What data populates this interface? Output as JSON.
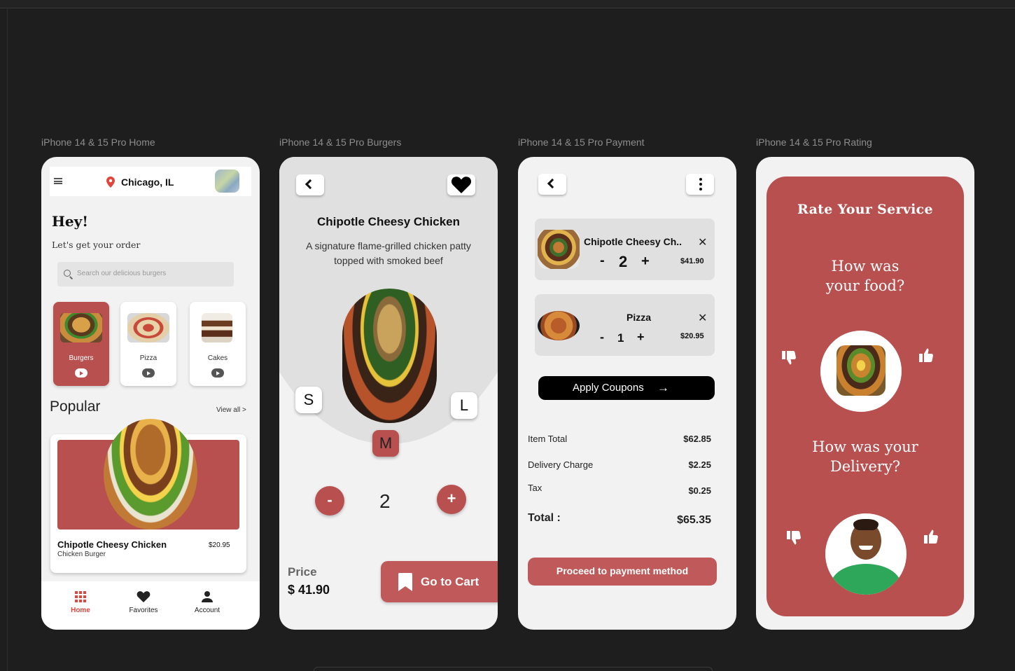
{
  "frames": {
    "home_label": "iPhone 14 & 15 Pro Home",
    "burgers_label": "iPhone 14 & 15 Pro Burgers",
    "payment_label": "iPhone 14 & 15 Pro Payment",
    "rating_label": "iPhone 14 & 15 Pro Rating"
  },
  "home": {
    "location": "Chicago, IL",
    "greeting": "Hey!",
    "subtitle": "Let's get your order",
    "search_placeholder": "Search our delicious burgers",
    "categories": [
      {
        "label": "Burgers",
        "active": true
      },
      {
        "label": "Pizza",
        "active": false
      },
      {
        "label": "Cakes",
        "active": false
      }
    ],
    "popular_title": "Popular",
    "view_all": "View all  >",
    "popular_item": {
      "name": "Chipotle Cheesy Chicken",
      "type": "Chicken Burger",
      "price": "$20.95"
    },
    "tabs": [
      {
        "label": "Home",
        "icon": "grid-icon",
        "active": true
      },
      {
        "label": "Favorites",
        "icon": "heart-icon",
        "active": false
      },
      {
        "label": "Account",
        "icon": "user-icon",
        "active": false
      }
    ]
  },
  "burgers": {
    "title": "Chipotle Cheesy Chicken",
    "description": "A signature flame-grilled chicken patty topped with smoked beef",
    "sizes": [
      "S",
      "M",
      "L"
    ],
    "selected_size": "M",
    "quantity": "2",
    "minus": "-",
    "plus": "+",
    "price_label": "Price",
    "price_value": "$ 41.90",
    "cart_button": "Go to Cart"
  },
  "payment": {
    "items": [
      {
        "name": "Chipotle Cheesy Ch..",
        "qty": "2",
        "price": "$41.90"
      },
      {
        "name": "Pizza",
        "qty": "1",
        "price": "$20.95"
      }
    ],
    "remove_symbol": "✕",
    "minus": "-",
    "plus": "+",
    "coupon_button": "Apply Coupons",
    "coupon_arrow": "→",
    "summary": [
      {
        "label": "Item Total",
        "value": "$62.85"
      },
      {
        "label": "Delivery Charge",
        "value": "$2.25"
      },
      {
        "label": "Tax",
        "value": "$0.25"
      }
    ],
    "total": {
      "label": "Total :",
      "value": "$65.35"
    },
    "proceed_button": "Proceed to payment method"
  },
  "rating": {
    "title": "Rate Your Service",
    "food_question": "How was your food?",
    "delivery_question": "How was your Delivery?"
  },
  "colors": {
    "brand": "#b85050",
    "accent_red": "#e0463c",
    "background": "#1e1e1e"
  }
}
